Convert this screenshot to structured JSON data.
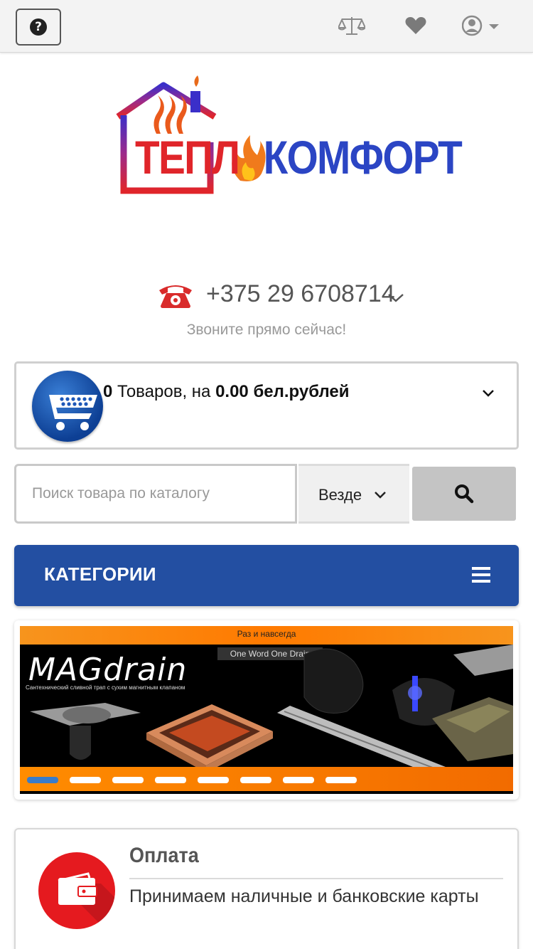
{
  "header": {
    "help_icon": "question-circle-icon",
    "compare_icon": "balance-scale-icon",
    "wishlist_icon": "heart-icon",
    "account_icon": "user-circle-icon",
    "background": "#f3f3f3"
  },
  "logo": {
    "text_part1": "ТЕПЛ",
    "text_part2": "КОМФОРТ",
    "colors": {
      "red": "#e0252a",
      "blue": "#2b45c4"
    }
  },
  "contact": {
    "phone": "+375 29 6708714",
    "note": "Звоните прямо сейчас!"
  },
  "cart": {
    "count": "0",
    "items_label": "Товаров,",
    "on_label": "на",
    "total": "0.00 бел.рублей"
  },
  "search": {
    "placeholder": "Поиск товара по каталогу",
    "scope": "Везде"
  },
  "categories": {
    "label": "КАТЕГОРИИ",
    "color": "#234fa2"
  },
  "banner": {
    "top_text": "Раз и навсегда",
    "tagline": "One Word   One Drain",
    "brand": "MAGdrain",
    "subtitle": "Сантехнический сливной трап с сухим магнитным клапаном",
    "slides": 8,
    "active_slide": 1
  },
  "payment": {
    "title": "Оплата",
    "text": "Принимаем наличные и банковские карты",
    "icon": "wallet-icon"
  }
}
